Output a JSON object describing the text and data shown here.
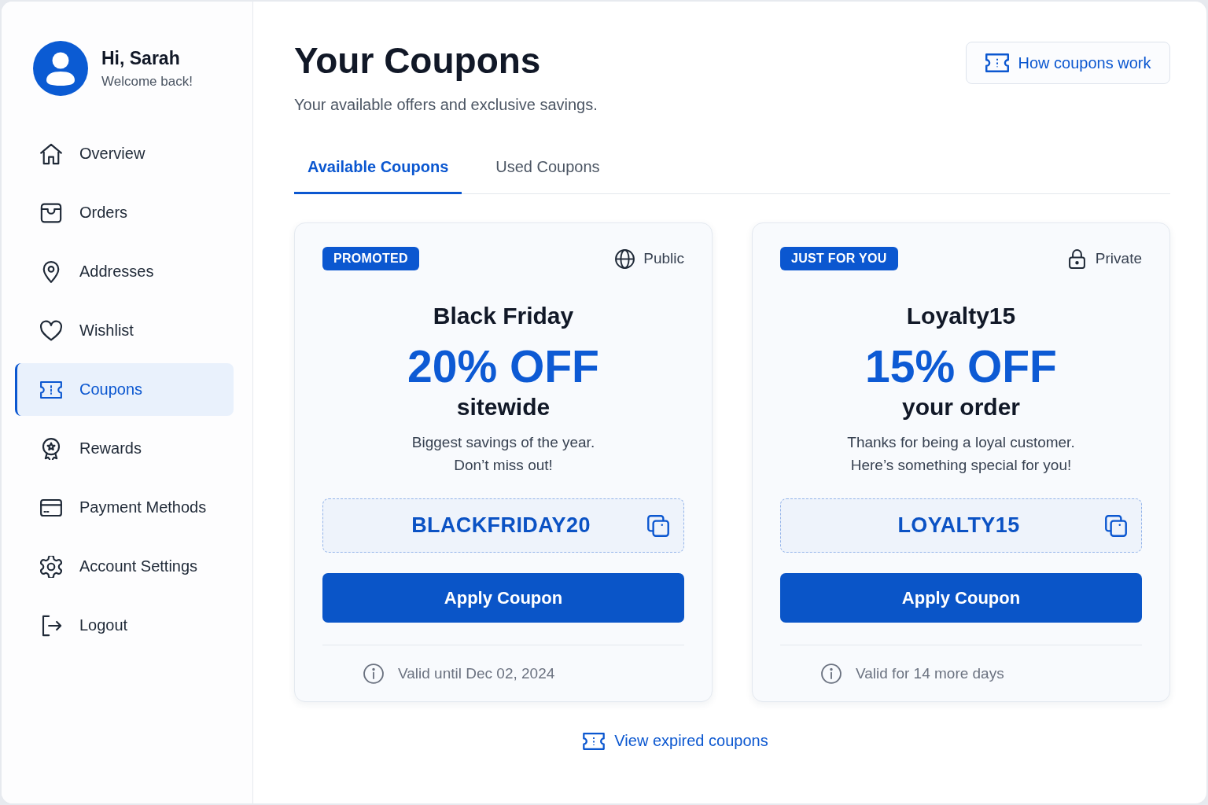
{
  "sidebar": {
    "user": {
      "greeting": "Hi, Sarah",
      "subtitle": "Welcome back!"
    },
    "items": [
      {
        "label": "Overview",
        "selected": false
      },
      {
        "label": "Orders",
        "selected": false
      },
      {
        "label": "Addresses",
        "selected": false
      },
      {
        "label": "Wishlist",
        "selected": false
      },
      {
        "label": "Coupons",
        "selected": true
      },
      {
        "label": "Rewards",
        "selected": false
      },
      {
        "label": "Payment Methods",
        "selected": false
      },
      {
        "label": "Account Settings",
        "selected": false
      },
      {
        "label": "Logout",
        "selected": false
      }
    ]
  },
  "header": {
    "title": "Your Coupons",
    "subtitle": "Your available offers and exclusive savings.",
    "help_button": "How coupons work"
  },
  "tabs": [
    {
      "label": "Available Coupons",
      "selected": true
    },
    {
      "label": "Used Coupons",
      "selected": false
    }
  ],
  "coupons": [
    {
      "badge": "PROMOTED",
      "kind": "public",
      "visibility": "Public",
      "title": "Black Friday",
      "discount": "20% OFF",
      "scope": "sitewide",
      "description": [
        "Biggest savings of the year.",
        "Don’t miss out!"
      ],
      "code": "BLACKFRIDAY20",
      "button": "Apply Coupon",
      "validity": "Valid until Dec 02, 2024"
    },
    {
      "badge": "JUST FOR YOU",
      "kind": "private",
      "visibility": "Private",
      "title": "Loyalty15",
      "discount": "15% OFF",
      "scope": "your order",
      "description": [
        "Thanks for being a loyal customer.",
        "Here’s something special for you!"
      ],
      "code": "LOYALTY15",
      "button": "Apply Coupon",
      "validity": "Valid for 14 more days"
    }
  ],
  "footer_link": "View expired coupons"
}
